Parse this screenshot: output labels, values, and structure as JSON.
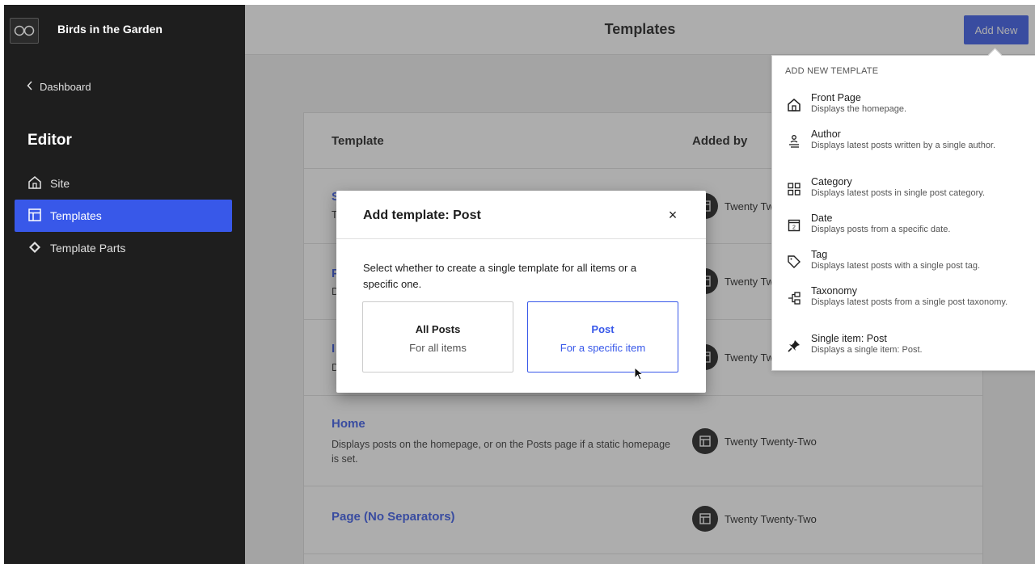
{
  "sidebar": {
    "site_title": "Birds in the Garden",
    "back_label": "Dashboard",
    "section_title": "Editor",
    "items": [
      {
        "label": "Site",
        "icon": "home-icon"
      },
      {
        "label": "Templates",
        "icon": "layout-icon"
      },
      {
        "label": "Template Parts",
        "icon": "diamond-icon"
      }
    ]
  },
  "header": {
    "title": "Templates",
    "add_new_label": "Add New"
  },
  "table": {
    "columns": [
      "Template",
      "Added by"
    ],
    "rows": [
      {
        "title": "S",
        "desc": "T",
        "author": "Twenty Tw"
      },
      {
        "title": "P",
        "desc": "D",
        "author": "Twenty Tw"
      },
      {
        "title": "I",
        "desc": "D",
        "author": "Twenty Tw"
      },
      {
        "title": "Home",
        "desc": "Displays posts on the homepage, or on the Posts page if a static homepage is set.",
        "author": "Twenty Twenty-Two"
      },
      {
        "title": "Page (No Separators)",
        "desc": "",
        "author": "Twenty Twenty-Two"
      }
    ]
  },
  "modal": {
    "title": "Add template: Post",
    "close_symbol": "×",
    "description": "Select whether to create a single template for all items or a specific one.",
    "options": [
      {
        "title": "All Posts",
        "subtitle": "For all items"
      },
      {
        "title": "Post",
        "subtitle": "For a specific item"
      }
    ]
  },
  "dropdown": {
    "heading": "ADD NEW TEMPLATE",
    "items": [
      {
        "label": "Front Page",
        "desc": "Displays the homepage.",
        "icon": "home-icon"
      },
      {
        "label": "Author",
        "desc": "Displays latest posts written by a single author.",
        "icon": "author-icon"
      },
      {
        "label": "Category",
        "desc": "Displays latest posts in single post category.",
        "icon": "category-icon"
      },
      {
        "label": "Date",
        "desc": "Displays posts from a specific date.",
        "icon": "date-icon"
      },
      {
        "label": "Tag",
        "desc": "Displays latest posts with a single post tag.",
        "icon": "tag-icon"
      },
      {
        "label": "Taxonomy",
        "desc": "Displays latest posts from a single post taxonomy.",
        "icon": "taxonomy-icon"
      },
      {
        "label": "Single item: Post",
        "desc": "Displays a single item: Post.",
        "icon": "pin-icon"
      }
    ]
  },
  "colors": {
    "accent": "#3858e9",
    "sidebar_bg": "#1e1e1e"
  }
}
